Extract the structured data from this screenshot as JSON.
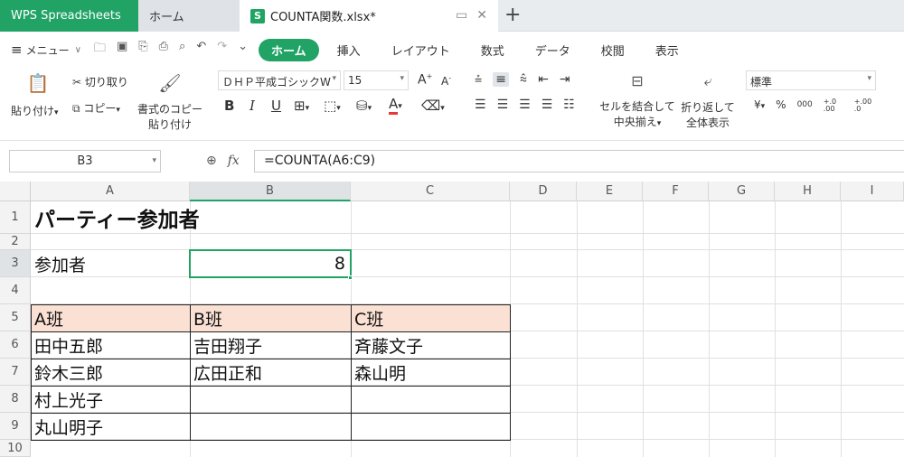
{
  "tabs": {
    "app": "WPS Spreadsheets",
    "home": "ホーム",
    "file": "COUNTA関数.xlsx*",
    "file_icon_letter": "S",
    "plus": "+"
  },
  "menu": {
    "label": "メニュー",
    "ribbon_tabs": [
      "ホーム",
      "挿入",
      "レイアウト",
      "数式",
      "データ",
      "校閲",
      "表示"
    ],
    "active_tab": "ホーム"
  },
  "ribbon": {
    "paste": "貼り付け",
    "cut": "切り取り",
    "copy": "コピー",
    "format_copy_1": "書式のコピー",
    "format_copy_2": "貼り付け",
    "font_name": "ＤＨＰ平成ゴシックW",
    "font_size": "15",
    "merge_1": "セルを結合して",
    "merge_2": "中央揃え",
    "wrap_1": "折り返して",
    "wrap_2": "全体表示",
    "number_format": "標準",
    "bold": "B",
    "italic": "I",
    "underline": "U",
    "font_color": "A",
    "yen": "¥",
    "percent": "%",
    "thousands": "000",
    "dec_inc": "+.0 .00",
    "dec_dec": "+.00 .0",
    "grow_font": "A",
    "shrink_font": "A"
  },
  "formula_bar": {
    "name_box": "B3",
    "fx": "fx",
    "formula": "=COUNTA(A6:C9)"
  },
  "columns": [
    "A",
    "B",
    "C",
    "D",
    "E",
    "F",
    "G",
    "H",
    "I"
  ],
  "rows": [
    "1",
    "2",
    "3",
    "4",
    "5",
    "6",
    "7",
    "8",
    "9",
    "10"
  ],
  "sheet": {
    "title": "パーティー参加者",
    "participants_label": "参加者",
    "participants_count": "8",
    "header": [
      "A班",
      "B班",
      "C班"
    ],
    "data": [
      [
        "田中五郎",
        "吉田翔子",
        "斉藤文子"
      ],
      [
        "鈴木三郎",
        "広田正和",
        "森山明"
      ],
      [
        "村上光子",
        "",
        ""
      ],
      [
        "丸山明子",
        "",
        ""
      ]
    ]
  },
  "colors": {
    "accent": "#21a366",
    "header_fill": "#fbe1d4"
  }
}
